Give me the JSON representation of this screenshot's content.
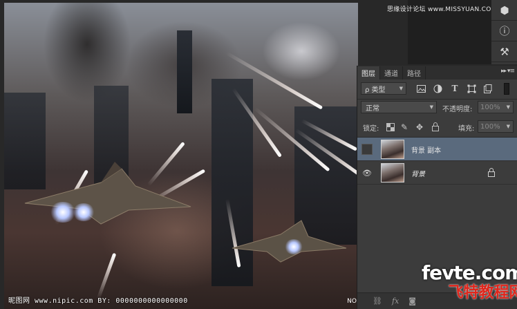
{
  "top_watermark": "思缘设计论坛 www.MISSYUAN.COM",
  "canvas_watermark": "昵图网 www.nipic.com   BY: 0000000000000000",
  "canvas_watermark_right": "NO",
  "layers_panel": {
    "tabs": [
      "图层",
      "通道",
      "路径"
    ],
    "active_tab": "图层",
    "menu_glyph": "▸▸ ▾≡",
    "filter_label": "ρ 类型",
    "blend_mode": "正常",
    "opacity_label": "不透明度:",
    "opacity_value": "100%",
    "lock_label": "锁定:",
    "fill_label": "填充:",
    "fill_value": "100%",
    "layers": [
      {
        "name": "背景 副本",
        "visible": false,
        "selected": true,
        "locked": false
      },
      {
        "name": "背景",
        "visible": true,
        "selected": false,
        "locked": true
      }
    ],
    "footer_icons": [
      "link-icon",
      "fx-icon",
      "mask-icon"
    ]
  },
  "site_watermark": {
    "domain": "fevte.com",
    "chinese": "飞特教程网"
  },
  "colors": {
    "panel_bg": "#3c3c3c",
    "selected_layer": "#5a6a7d",
    "watermark_red": "#e0261c"
  }
}
